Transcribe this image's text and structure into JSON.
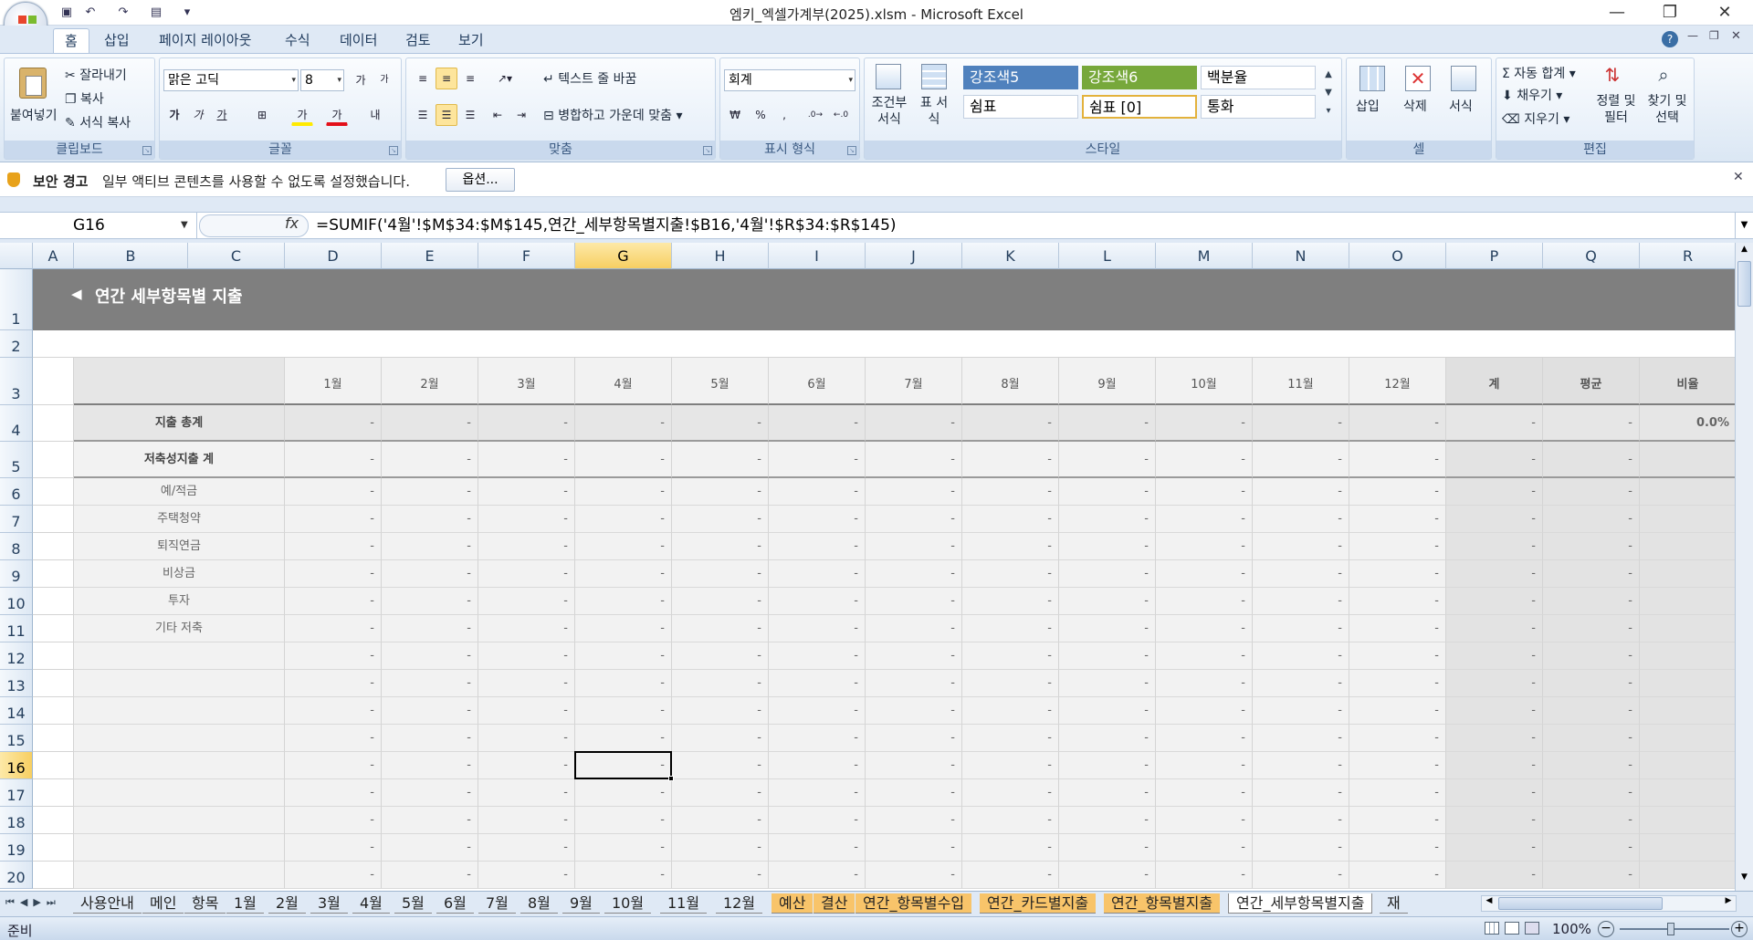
{
  "window": {
    "title": "엠키_엑셀가계부(2025).xlsm - Microsoft Excel"
  },
  "ribbon_tabs": [
    "홈",
    "삽입",
    "페이지 레이아웃",
    "수식",
    "데이터",
    "검토",
    "보기"
  ],
  "clipboard": {
    "paste": "붙여넣기",
    "cut": "잘라내기",
    "copy": "복사",
    "format_painter": "서식 복사",
    "label": "클립보드"
  },
  "font": {
    "name": "맑은 고딕",
    "size": "8",
    "label": "글꼴",
    "grow": "가",
    "shrink": "가",
    "bold": "가",
    "italic": "가",
    "underline": "가",
    "fill_glyph": "가",
    "font_color_glyph": "가",
    "phonetic": "내"
  },
  "alignment": {
    "wrap": "텍스트 줄 바꿈",
    "merge": "병합하고 가운데 맞춤",
    "label": "맞춤"
  },
  "number": {
    "format": "회계",
    "currency": "₩",
    "percent": "%",
    "comma": ",",
    "label": "표시 형식"
  },
  "styles": {
    "conditional": "조건부 서식",
    "table": "표 서식",
    "cells": [
      "강조색5",
      "강조색6",
      "백분율",
      "쉼표",
      "쉼표 [0]",
      "통화"
    ],
    "label": "스타일"
  },
  "cells_group": {
    "insert": "삽입",
    "delete": "삭제",
    "format": "서식",
    "label": "셀"
  },
  "editing": {
    "autosum": "자동 합계",
    "fill": "채우기",
    "clear": "지우기",
    "sort": "정렬 및 필터",
    "find": "찾기 및 선택",
    "label": "편집"
  },
  "security": {
    "title": "보안 경고",
    "message": "일부 액티브 콘텐츠를 사용할 수 없도록 설정했습니다.",
    "button": "옵션..."
  },
  "formula_bar": {
    "name_box": "G16",
    "fx": "fx",
    "formula": "=SUMIF('4월'!$M$34:$M$145,연간_세부항목별지출!$B16,'4월'!$R$34:$R$145)"
  },
  "columns": [
    "A",
    "B",
    "C",
    "D",
    "E",
    "F",
    "G",
    "H",
    "I",
    "J",
    "K",
    "L",
    "M",
    "N",
    "O",
    "P",
    "Q",
    "R"
  ],
  "rows": [
    "1",
    "2",
    "3",
    "4",
    "5",
    "6",
    "7",
    "8",
    "9",
    "10",
    "11",
    "12",
    "13",
    "14",
    "15",
    "16",
    "17",
    "18",
    "19",
    "20"
  ],
  "sheet": {
    "title": "연간 세부항목별 지출",
    "title_arrow": "◀",
    "headers": [
      "1월",
      "2월",
      "3월",
      "4월",
      "5월",
      "6월",
      "7월",
      "8월",
      "9월",
      "10월",
      "11월",
      "12월",
      "계",
      "평균",
      "비율"
    ],
    "total_label": "지출 총계",
    "total_ratio": "0.0%",
    "saving_label": "저축성지출 계",
    "items": [
      "예/적금",
      "주택청약",
      "퇴직연금",
      "비상금",
      "투자",
      "기타 저축"
    ],
    "empty_value": "-"
  },
  "sheet_tabs": [
    "사용안내",
    "메인",
    "항목",
    "1월",
    "2월",
    "3월",
    "4월",
    "5월",
    "6월",
    "7월",
    "8월",
    "9월",
    "10월",
    "11월",
    "12월",
    "예산",
    "결산",
    "연간_항목별수입",
    "연간_카드별지출",
    "연간_항목별지출",
    "연간_세부항목별지출",
    "재"
  ],
  "status": {
    "ready": "준비",
    "zoom": "100%"
  }
}
